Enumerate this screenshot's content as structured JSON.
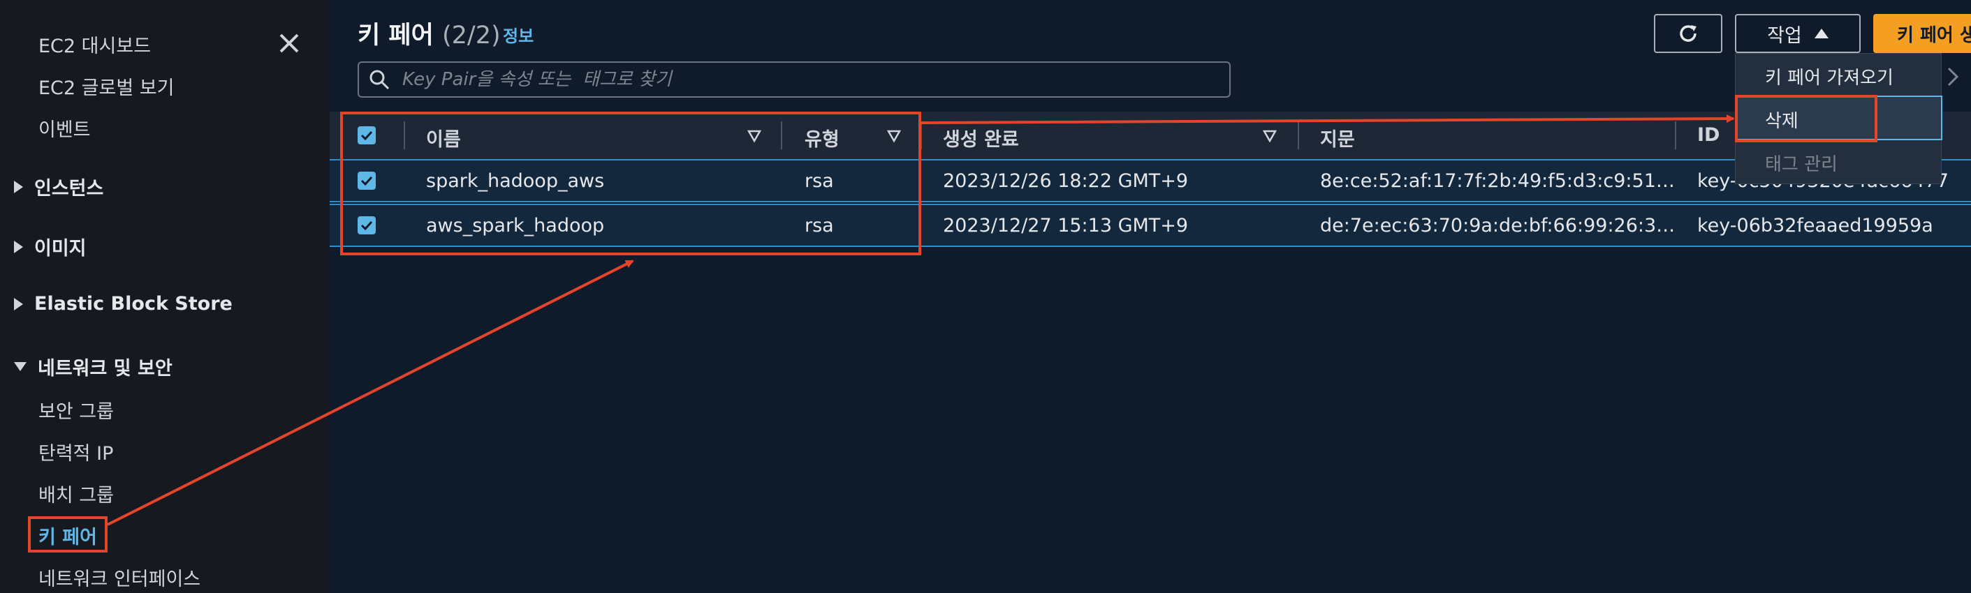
{
  "sidebar": {
    "items": [
      {
        "label": "EC2 대시보드"
      },
      {
        "label": "EC2 글로벌 보기"
      },
      {
        "label": "이벤트"
      }
    ],
    "sections": [
      {
        "label": "인스턴스",
        "expanded": false
      },
      {
        "label": "이미지",
        "expanded": false
      },
      {
        "label": "Elastic Block Store",
        "expanded": false
      },
      {
        "label": "네트워크 및 보안",
        "expanded": true
      }
    ],
    "network_items": [
      {
        "label": "보안 그룹"
      },
      {
        "label": "탄력적 IP"
      },
      {
        "label": "배치 그룹"
      },
      {
        "label": "키 페어",
        "active": true
      },
      {
        "label": "네트워크 인터페이스"
      }
    ]
  },
  "header": {
    "title": "키 페어",
    "count": "(2/2)",
    "info_link": "정보"
  },
  "search": {
    "placeholder": "Key Pair을 속성 또는  태그로 찾기"
  },
  "toolbar": {
    "actions_label": "작업",
    "create_label": "키 페어 생성"
  },
  "dropdown": {
    "items": [
      {
        "label": "키 페어 가져오기",
        "disabled": false
      },
      {
        "label": "삭제",
        "disabled": false,
        "selected": true
      },
      {
        "label": "태그 관리",
        "disabled": true
      }
    ]
  },
  "table": {
    "columns": [
      "이름",
      "유형",
      "생성 완료",
      "지문",
      "ID"
    ],
    "rows": [
      {
        "name": "spark_hadoop_aws",
        "type": "rsa",
        "created": "2023/12/26 18:22 GMT+9",
        "fingerprint": "8e:ce:52:af:17:7f:2b:49:f5:d3:c9:51…",
        "id": "key-0c5049320e4ac66477"
      },
      {
        "name": "aws_spark_hadoop",
        "type": "rsa",
        "created": "2023/12/27 15:13 GMT+9",
        "fingerprint": "de:7e:ec:63:70:9a:de:bf:66:99:26:3…",
        "id": "key-06b32feaaed19959a"
      }
    ]
  },
  "colors": {
    "accent": "#5fb7e8",
    "primary_button": "#f59f22",
    "annotation": "#e3452b",
    "background": "#0f1b2a",
    "sidebar": "#16191f"
  }
}
